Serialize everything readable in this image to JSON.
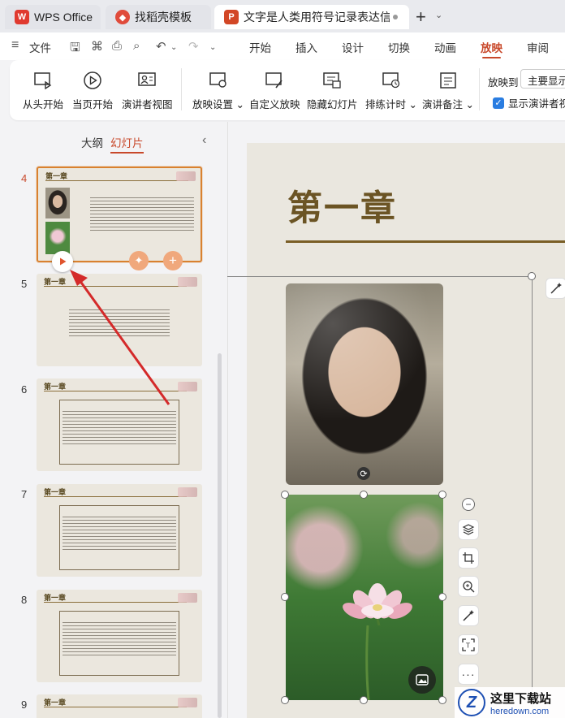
{
  "tabs": [
    {
      "label": "WPS Office",
      "icon": "wps-logo-icon"
    },
    {
      "label": "找稻壳模板",
      "icon": "docer-icon"
    },
    {
      "label": "文字是人类用符号记录表达信息以",
      "icon": "presentation-file-icon"
    }
  ],
  "menu": {
    "file": "文件",
    "items": [
      "开始",
      "插入",
      "设计",
      "切换",
      "动画",
      "放映",
      "审阅"
    ],
    "active": "放映"
  },
  "ribbon": {
    "buttons": [
      "从头开始",
      "当页开始",
      "演讲者视图",
      "放映设置",
      "自定义放映",
      "隐藏幻灯片",
      "排练计时",
      "演讲备注"
    ],
    "play_to_label": "放映到",
    "play_to_value": "主要显示器",
    "presenter_view_checkbox": "显示演讲者视图"
  },
  "panel": {
    "tab_outline": "大纲",
    "tab_slides": "幻灯片",
    "slide_numbers": [
      "4",
      "5",
      "6",
      "7",
      "8",
      "9"
    ],
    "slide_title": "第一章"
  },
  "slide": {
    "title": "第一章"
  },
  "watermark": {
    "logo_letter": "Z",
    "title": "这里下载站",
    "url": "heredown.com"
  },
  "colors": {
    "accent": "#c8482a",
    "selected_border": "#d9812f",
    "slide_bg": "#eae7df",
    "title_color": "#6b5424",
    "arrow": "#d42a2a"
  }
}
